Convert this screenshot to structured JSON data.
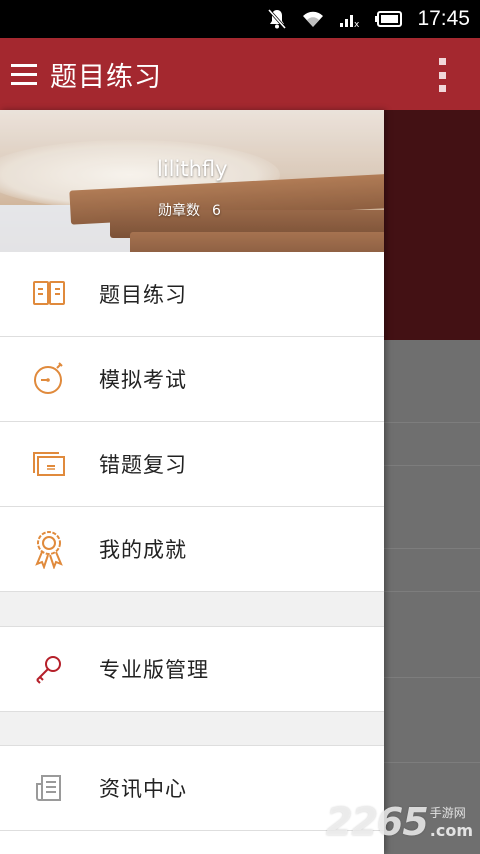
{
  "status_bar": {
    "time": "17:45",
    "icons": [
      "notifications-muted-icon",
      "wifi-icon",
      "signal-icon",
      "battery-icon"
    ]
  },
  "app_bar": {
    "title": "题目练习",
    "color": "#a4282f",
    "icons": [
      "menu-icon",
      "overflow-menu-icon"
    ]
  },
  "drawer": {
    "header": {
      "username": "lilithfly",
      "badge_label": "勋章数",
      "badge_count": "6"
    },
    "items": [
      {
        "label": "题目练习",
        "icon": "open-book-icon"
      },
      {
        "label": "模拟考试",
        "icon": "stopwatch-icon"
      },
      {
        "label": "错题复习",
        "icon": "cards-icon"
      },
      {
        "label": "我的成就",
        "icon": "medal-icon"
      },
      {
        "label": "专业版管理",
        "icon": "key-icon"
      },
      {
        "label": "资讯中心",
        "icon": "newspaper-icon"
      }
    ],
    "accent_color": "#e08a3c",
    "key_icon_color": "#b5202a"
  },
  "watermark": {
    "digits": "2265",
    "cn_text": "手游网",
    "com_text": ".com"
  }
}
